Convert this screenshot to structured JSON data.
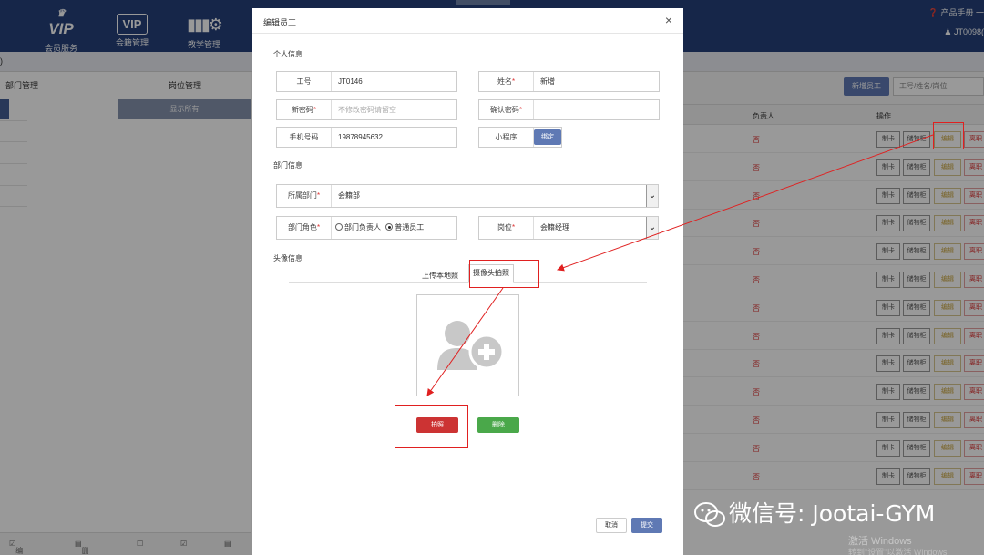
{
  "topnav": {
    "items": [
      {
        "icon": "vip-crown-icon",
        "glyph": "VIP",
        "label": "会员服务"
      },
      {
        "icon": "vip-card-icon",
        "glyph": "VIP",
        "label": "会籍管理"
      },
      {
        "icon": "books-gear-icon",
        "glyph": "",
        "label": "教学管理"
      }
    ],
    "manual": "产品手册",
    "manual_extra": "一",
    "user": "JT0098("
  },
  "subbar": {
    "crumb": ")"
  },
  "left_panel": {
    "dept_head": "部门管理",
    "post_head": "岗位管理",
    "show_all": "显示所有",
    "footer": {
      "edit": "编辑",
      "delete": "删除"
    }
  },
  "right_panel": {
    "add_employee": "新增员工",
    "search_placeholder": "工号/姓名/岗位",
    "col_owner": "负责人",
    "col_ops": "操作",
    "rows": [
      {
        "owner": "否"
      },
      {
        "owner": "否"
      },
      {
        "owner": "否"
      },
      {
        "owner": "否"
      },
      {
        "owner": "否"
      },
      {
        "owner": "否"
      },
      {
        "owner": "否"
      },
      {
        "owner": "否"
      },
      {
        "owner": "否"
      },
      {
        "owner": "否"
      },
      {
        "owner": "否"
      },
      {
        "owner": "否"
      },
      {
        "owner": "否"
      }
    ],
    "ops": {
      "card": "制卡",
      "locker": "储物柜",
      "edit": "编辑",
      "leave": "离职"
    }
  },
  "modal": {
    "title": "编辑员工",
    "close": "×",
    "personal": {
      "title": "个人信息",
      "emp_no": {
        "label": "工号",
        "value": "JT0146"
      },
      "name": {
        "label": "姓名",
        "value": "新增"
      },
      "new_password": {
        "label": "新密码",
        "placeholder": "不修改密码请留空"
      },
      "confirm_password": {
        "label": "确认密码",
        "value": ""
      },
      "phone": {
        "label": "手机号码",
        "value": "19878945632"
      },
      "miniapp": {
        "label": "小程序",
        "button": "绑定"
      }
    },
    "dept": {
      "title": "部门信息",
      "department": {
        "label": "所属部门",
        "value": "会籍部"
      },
      "role": {
        "label": "部门角色",
        "options": [
          "部门负责人",
          "普通员工"
        ],
        "selected": "普通员工"
      },
      "position": {
        "label": "岗位",
        "value": "会籍经理"
      }
    },
    "avatar": {
      "title": "头像信息",
      "tab_upload": "上传本地照",
      "tab_camera": "摄像头拍照",
      "active_tab": "摄像头拍照",
      "capture_button": "拍照",
      "delete_button": "删除"
    },
    "cancel": "取消",
    "submit": "提交"
  },
  "watermark": {
    "text": "微信号: Jootai-GYM",
    "windows_1": "激活 Windows",
    "windows_2": "转到\"设置\"以激活 Windows"
  },
  "colors": {
    "topbar": "#25407a",
    "primary_button": "#5f79b4",
    "danger_button": "#cc3333",
    "success_button": "#4aa84a",
    "annotation": "#e02020"
  }
}
